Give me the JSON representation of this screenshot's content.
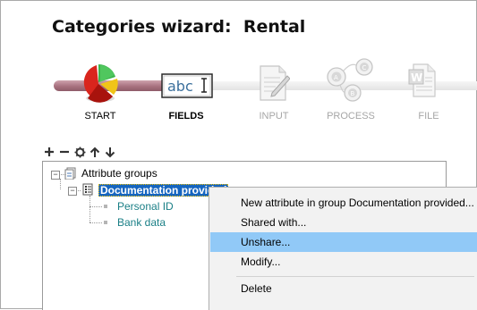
{
  "title": "Categories wizard:  Rental",
  "colors": {
    "rail_done": "#a8717f",
    "selection": "#1565c0",
    "menu_highlight": "#91c9f7",
    "leaf_text": "#1a7f86"
  },
  "steps": [
    {
      "label": "START",
      "icon": "pie-chart-icon",
      "state": "done"
    },
    {
      "label": "FIELDS",
      "icon": "text-field-icon",
      "state": "current"
    },
    {
      "label": "INPUT",
      "icon": "document-edit-icon",
      "state": "pending"
    },
    {
      "label": "PROCESS",
      "icon": "process-circles-icon",
      "state": "pending"
    },
    {
      "label": "FILE",
      "icon": "word-file-icon",
      "state": "pending"
    }
  ],
  "fields_icon_text": "abc",
  "toolbar": [
    {
      "name": "add-icon"
    },
    {
      "name": "remove-icon"
    },
    {
      "name": "settings-icon"
    },
    {
      "name": "move-up-icon"
    },
    {
      "name": "move-down-icon"
    }
  ],
  "tree": {
    "root": {
      "label": "Attribute groups",
      "expander": "−"
    },
    "group": {
      "label": "Documentation provided",
      "expander": "−"
    },
    "leaves": [
      {
        "label": "Personal ID"
      },
      {
        "label": "Bank data"
      }
    ]
  },
  "context_menu": {
    "items": [
      {
        "label": "New attribute in group Documentation provided..."
      },
      {
        "label": "Shared with..."
      },
      {
        "label": "Unshare..."
      },
      {
        "label": "Modify..."
      },
      {
        "label": "Delete"
      }
    ]
  }
}
